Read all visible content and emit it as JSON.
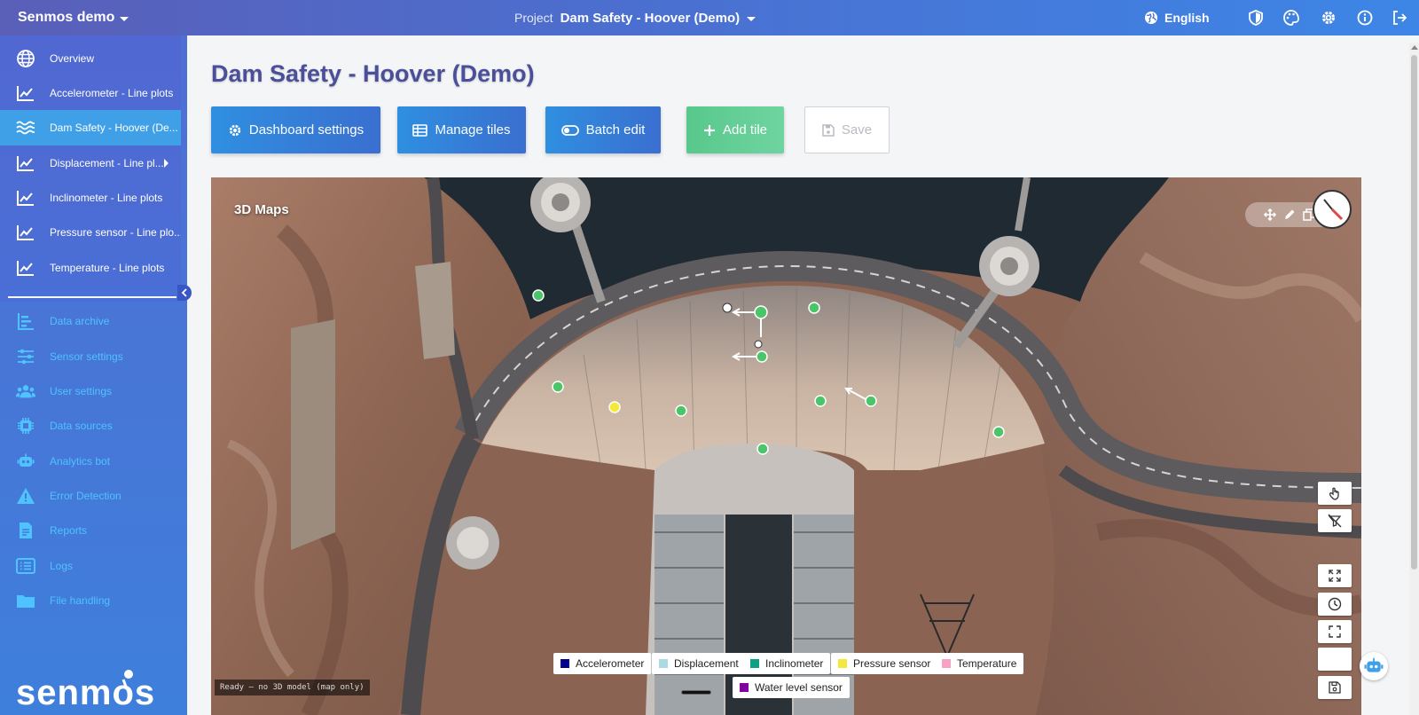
{
  "header": {
    "org_name": "Senmos demo",
    "project_label": "Project",
    "project_name": "Dam Safety - Hoover (Demo)",
    "language": "English"
  },
  "sidebar": {
    "items": [
      {
        "label": "Overview",
        "icon": "globe-icon"
      },
      {
        "label": "Accelerometer - Line plots",
        "icon": "line-chart-icon"
      },
      {
        "label": "Dam Safety - Hoover (De...",
        "icon": "waves-icon",
        "active": true
      },
      {
        "label": "Displacement - Line pl...",
        "icon": "line-chart-icon"
      },
      {
        "label": "Inclinometer - Line plots",
        "icon": "line-chart-icon"
      },
      {
        "label": "Pressure sensor - Line plo...",
        "icon": "line-chart-icon"
      },
      {
        "label": "Temperature - Line plots",
        "icon": "line-chart-icon"
      }
    ],
    "tools": [
      {
        "label": "Data archive",
        "icon": "bar-list-icon"
      },
      {
        "label": "Sensor settings",
        "icon": "sliders-icon"
      },
      {
        "label": "User settings",
        "icon": "users-icon"
      },
      {
        "label": "Data sources",
        "icon": "chip-icon"
      },
      {
        "label": "Analytics bot",
        "icon": "robot-icon"
      },
      {
        "label": "Error Detection",
        "icon": "warning-icon"
      },
      {
        "label": "Reports",
        "icon": "report-icon"
      },
      {
        "label": "Logs",
        "icon": "list-icon"
      },
      {
        "label": "File handling",
        "icon": "folder-icon"
      }
    ],
    "logo_text": "senmos"
  },
  "page": {
    "title": "Dam Safety - Hoover (Demo)",
    "buttons": {
      "dashboard_settings": "Dashboard settings",
      "manage_tiles": "Manage tiles",
      "batch_edit": "Batch edit",
      "add_tile": "Add tile",
      "save": "Save"
    }
  },
  "map": {
    "title": "3D Maps",
    "status": "Ready — no 3D model (map only)",
    "legend": [
      {
        "label": "Accelerometer",
        "color": "#00008b"
      },
      {
        "label": "Displacement",
        "color": "#add8e6"
      },
      {
        "label": "Inclinometer",
        "color": "#0f9f83"
      },
      {
        "label": "Pressure sensor",
        "color": "#f4e93b"
      },
      {
        "label": "Temperature",
        "color": "#f7a1c4"
      },
      {
        "label": "Water level sensor",
        "color": "#8000a0"
      }
    ]
  },
  "colors": {
    "accent": "#3a6fd0",
    "title": "#4b4f9a",
    "sidebar_active": "#3fa0e8",
    "tool_text": "#4ec3ff",
    "sensor_green": "#4cc46a"
  }
}
